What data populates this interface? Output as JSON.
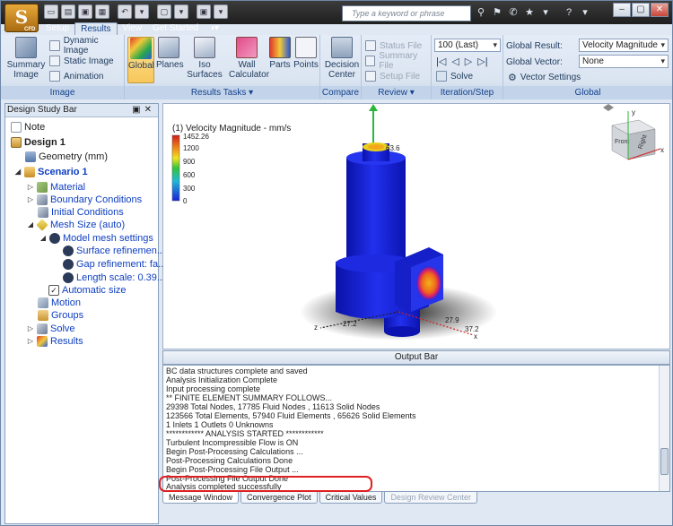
{
  "app": {
    "logo_letter": "S",
    "logo_sub": "CFD"
  },
  "search": {
    "placeholder": "Type a keyword or phrase"
  },
  "tabs": [
    "Setup",
    "Results",
    "View",
    "Get Started"
  ],
  "ribbon": {
    "image": {
      "label": "Image",
      "summary": "Summary Image",
      "dynamic": "Dynamic Image",
      "static": "Static Image",
      "animation": "Animation"
    },
    "results_tasks": {
      "label": "Results Tasks",
      "global": "Global",
      "planes": "Planes",
      "iso": "Iso Surfaces",
      "wall": "Wall Calculator",
      "parts": "Parts",
      "points": "Points"
    },
    "compare": {
      "label": "Compare",
      "decision": "Decision Center"
    },
    "review": {
      "label": "Review",
      "status": "Status File",
      "summary": "Summary File",
      "setup": "Setup File"
    },
    "iteration": {
      "label": "Iteration/Step",
      "value": "100 (Last)",
      "solve": "Solve"
    },
    "global": {
      "label": "Global",
      "result_label": "Global Result:",
      "result_value": "Velocity Magnitude",
      "vector_label": "Global Vector:",
      "vector_value": "None",
      "vector_settings": "Vector Settings"
    }
  },
  "design_study": {
    "title": "Design Study Bar",
    "items": [
      {
        "label": "Note"
      },
      {
        "label": "Design 1"
      },
      {
        "label": "Geometry (mm)"
      },
      {
        "label": "Scenario 1"
      },
      {
        "label": "Material"
      },
      {
        "label": "Boundary Conditions"
      },
      {
        "label": "Initial Conditions"
      },
      {
        "label": "Mesh Size (auto)"
      },
      {
        "label": "Model mesh settings"
      },
      {
        "label": "Surface refinemen..."
      },
      {
        "label": "Gap refinement: fa..."
      },
      {
        "label": "Length scale: 0.39..."
      },
      {
        "label": "Automatic size"
      },
      {
        "label": "Motion"
      },
      {
        "label": "Groups"
      },
      {
        "label": "Solve"
      },
      {
        "label": "Results"
      }
    ]
  },
  "viewport": {
    "legend_title": "(1) Velocity Magnitude - mm/s",
    "legend_ticks": [
      "1452.26",
      "1200",
      "900",
      "600",
      "300",
      "0"
    ],
    "dims": [
      "63.6",
      "27.2",
      "27.9",
      "37.2"
    ],
    "axes": {
      "x": "x",
      "y": "y",
      "z": "z"
    },
    "viewcube": {
      "front": "Front",
      "right": "Right"
    }
  },
  "output": {
    "title": "Output Bar",
    "lines": [
      "BC data structures complete and saved",
      "Analysis Initialization Complete",
      "Input processing complete",
      "** FINITE ELEMENT SUMMARY FOLLOWS...",
      "29398 Total Nodes,   17785 Fluid Nodes ,   11613 Solid Nodes",
      "123566 Total Elements,  57940 Fluid Elements ,   65626 Solid Elements",
      "1 Inlets    1 Outlets    0 Unknowns",
      "************ ANALYSIS STARTED ************",
      "Turbulent Incompressible Flow is ON",
      "Begin Post-Processing Calculations ...",
      "Post-Processing Calculations Done",
      "Begin Post-Processing File Output ...",
      "Post-Processing File Output Done",
      "Analysis completed successfully"
    ],
    "tabs": [
      "Message Window",
      "Convergence Plot",
      "Critical Values",
      "Design Review Center"
    ]
  },
  "colors": {
    "accent": "#15428b",
    "highlight": "#e02020",
    "model": "#1a22d8"
  }
}
